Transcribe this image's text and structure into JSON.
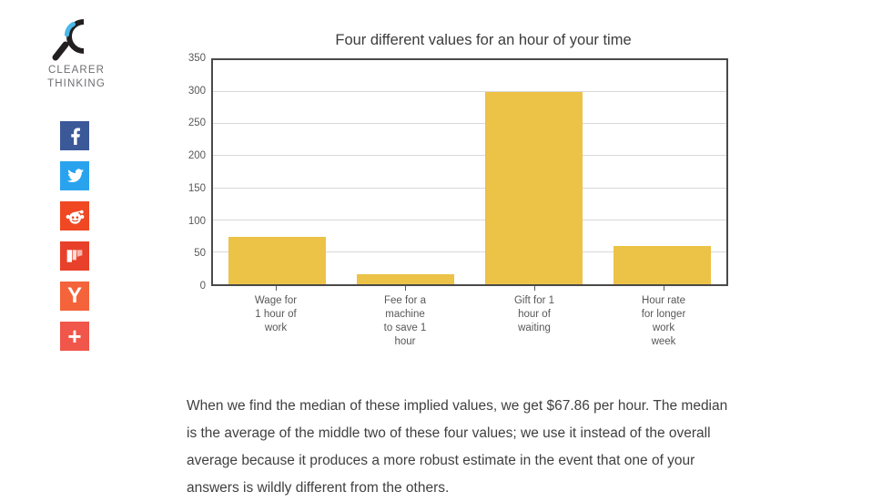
{
  "brand": {
    "logo_icon": "magnifying-glass-c-icon",
    "name_line_1": "CLEARER",
    "name_line_2": "THINKING"
  },
  "share": {
    "items": [
      {
        "name": "facebook",
        "icon": "facebook-icon",
        "glyph": "f",
        "label": "Facebook",
        "color": "#3b5998"
      },
      {
        "name": "twitter",
        "icon": "twitter-bird-icon",
        "glyph": "",
        "label": "Twitter",
        "color": "#2aa3ef"
      },
      {
        "name": "reddit",
        "icon": "reddit-alien-icon",
        "glyph": "",
        "label": "Reddit",
        "color": "#ef4823"
      },
      {
        "name": "mix",
        "icon": "mix-icon",
        "glyph": "",
        "label": "Mix",
        "color": "#e8402a"
      },
      {
        "name": "hackernews",
        "icon": "hacker-news-y-icon",
        "glyph": "Y",
        "label": "Hacker News",
        "color": "#f4633a"
      },
      {
        "name": "more",
        "icon": "plus-icon",
        "glyph": "+",
        "label": "More",
        "color": "#f0564a"
      }
    ]
  },
  "chart_data": {
    "type": "bar",
    "title": "Four different values for an hour of your time",
    "xlabel": "",
    "ylabel": "",
    "ylim": [
      0,
      350
    ],
    "yticks": [
      0,
      50,
      100,
      150,
      200,
      250,
      300,
      350
    ],
    "grid": true,
    "legend": "none",
    "bar_color": "#ecc247",
    "categories": [
      "Wage for\n1 hour of\nwork",
      "Fee for a\nmachine\nto save 1\nhour",
      "Gift for 1\nhour of\nwaiting",
      "Hour rate\nfor longer\nwork\nweek"
    ],
    "category_lines": [
      [
        "Wage for",
        "1 hour of",
        "work"
      ],
      [
        "Fee for a",
        "machine",
        "to save 1",
        "hour"
      ],
      [
        "Gift for 1",
        "hour of",
        "waiting"
      ],
      [
        "Hour rate",
        "for longer",
        "work",
        "week"
      ]
    ],
    "values": [
      74,
      15,
      300,
      60
    ]
  },
  "body": {
    "paragraph": "When we find the median of these implied values, we get $67.86 per hour. The median is the average of the middle two of these four values; we use it instead of the overall average because it produces a more robust estimate in the event that one of your answers is wildly different from the others."
  }
}
